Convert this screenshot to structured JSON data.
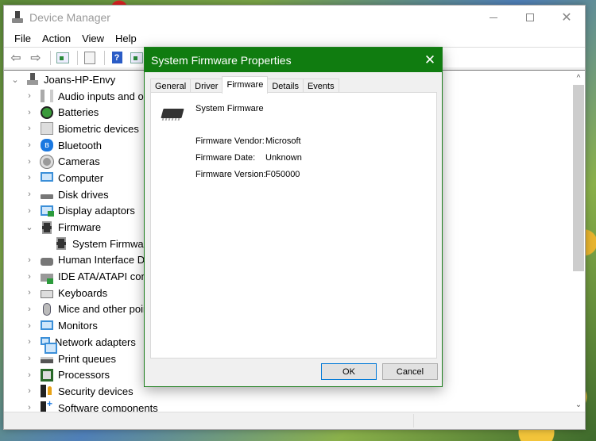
{
  "window": {
    "title": "Device Manager",
    "controls": {
      "minimize": "minimize",
      "maximize": "maximize",
      "close": "✕"
    }
  },
  "menubar": [
    "File",
    "Action",
    "View",
    "Help"
  ],
  "toolbar": {
    "buttons": [
      "back-arrow-icon",
      "forward-arrow-icon",
      "show-hide-console-tree-icon",
      "properties-icon",
      "help-icon",
      "action-pane-icon",
      "scan-hardware-icon"
    ],
    "help_glyph": "?"
  },
  "tree": {
    "root": "Joans-HP-Envy",
    "items": [
      {
        "label": "Audio inputs and outputs",
        "icon": "speaker-icon",
        "expanded": false
      },
      {
        "label": "Batteries",
        "icon": "battery-icon",
        "expanded": false
      },
      {
        "label": "Biometric devices",
        "icon": "fingerprint-icon",
        "expanded": false
      },
      {
        "label": "Bluetooth",
        "icon": "bluetooth-icon",
        "expanded": false
      },
      {
        "label": "Cameras",
        "icon": "webcam-icon",
        "expanded": false
      },
      {
        "label": "Computer",
        "icon": "monitor-icon",
        "expanded": false
      },
      {
        "label": "Disk drives",
        "icon": "disk-drive-icon",
        "expanded": false
      },
      {
        "label": "Display adaptors",
        "icon": "display-adapter-icon",
        "expanded": false
      },
      {
        "label": "Firmware",
        "icon": "chip-icon",
        "expanded": true,
        "children": [
          {
            "label": "System Firmware",
            "icon": "chip-icon"
          }
        ]
      },
      {
        "label": "Human Interface Devices",
        "icon": "hid-icon",
        "expanded": false
      },
      {
        "label": "IDE ATA/ATAPI controllers",
        "icon": "ide-controller-icon",
        "expanded": false
      },
      {
        "label": "Keyboards",
        "icon": "keyboard-icon",
        "expanded": false
      },
      {
        "label": "Mice and other pointing devices",
        "icon": "mouse-icon",
        "expanded": false
      },
      {
        "label": "Monitors",
        "icon": "monitor-icon",
        "expanded": false
      },
      {
        "label": "Network adapters",
        "icon": "network-icon",
        "expanded": false
      },
      {
        "label": "Print queues",
        "icon": "printer-icon",
        "expanded": false
      },
      {
        "label": "Processors",
        "icon": "processor-icon",
        "expanded": false
      },
      {
        "label": "Security devices",
        "icon": "security-key-icon",
        "expanded": false
      },
      {
        "label": "Software components",
        "icon": "software-component-icon",
        "expanded": false
      }
    ],
    "chevron_collapsed": "›",
    "chevron_expanded": "⌄"
  },
  "scrollbar": {
    "up": "^",
    "down": "⌄"
  },
  "dialog": {
    "title": "System Firmware Properties",
    "close": "✕",
    "tabs": [
      "General",
      "Driver",
      "Firmware",
      "Details",
      "Events"
    ],
    "active_tab": "Firmware",
    "device_name": "System Firmware",
    "properties": [
      {
        "label": "Firmware Vendor:",
        "value": "Microsoft"
      },
      {
        "label": "Firmware Date:",
        "value": "Unknown"
      },
      {
        "label": "Firmware Version:",
        "value": "F050000"
      }
    ],
    "ok_label": "OK",
    "cancel_label": "Cancel",
    "accent_color": "#107c10"
  }
}
